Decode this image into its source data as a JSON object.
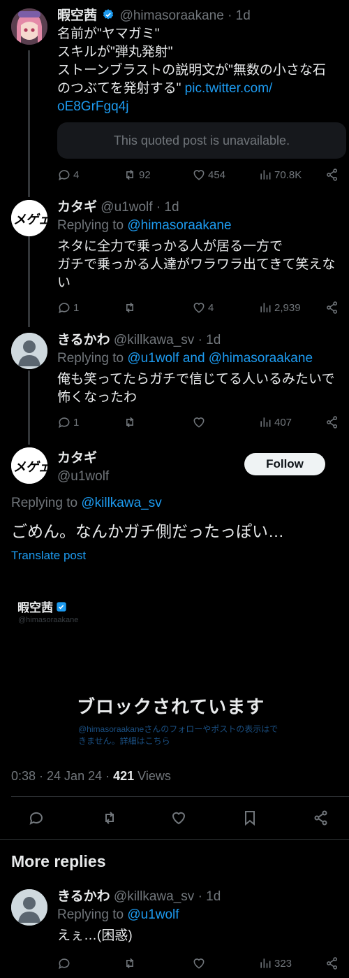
{
  "tweets": [
    {
      "name": "暇空茜",
      "handle": "@himasoraakane",
      "time": "· 1d",
      "text_lines": [
        "名前が\"ヤマガミ\"",
        "スキルが\"弾丸発射\"",
        "ストーンブラストの説明文が\"無数の小さな石",
        "のつぶてを発射する\""
      ],
      "link_inline": "pic.twitter.com/",
      "link_rest": "oE8GrFgq4j",
      "quoted": "This quoted post is unavailable.",
      "replies": "4",
      "retweets": "92",
      "likes": "454",
      "views": "70.8K"
    },
    {
      "name": "カタギ",
      "handle": "@u1wolf",
      "time": "· 1d",
      "replying_label": "Replying to",
      "replying_to": "@himasoraakane",
      "text_lines": [
        "ネタに全力で乗っかる人が居る一方で",
        "ガチで乗っかる人達がワラワラ出てきて笑えな",
        "い"
      ],
      "replies": "1",
      "retweets": "",
      "likes": "4",
      "views": "2,939"
    },
    {
      "name": "きるかわ",
      "handle": "@killkawa_sv",
      "time": "· 1d",
      "replying_label": "Replying to",
      "replying_to": "@u1wolf and @himasoraakane",
      "text_lines": [
        "俺も笑ってたらガチで信じてる人いるみたいで",
        "怖くなったわ"
      ],
      "replies": "1",
      "retweets": "",
      "likes": "",
      "views": "407"
    }
  ],
  "main": {
    "name": "カタギ",
    "handle": "@u1wolf",
    "follow_label": "Follow",
    "replying_label": "Replying to",
    "replying_to": "@killkawa_sv",
    "text": "ごめん。なんかガチ側だったっぽい…",
    "translate": "Translate post",
    "image": {
      "name": "暇空茜",
      "handle": "@himasoraakane",
      "block_title": "ブロックされています",
      "block_desc_line1": "@himasoraakaneさんのフォローやポストの表示はで",
      "block_desc_line2": "きません。詳細はこちら"
    },
    "time": "0:38 · 24 Jan 24 ·",
    "views_count": "421",
    "views_label": "Views"
  },
  "more_replies": {
    "title": "More replies",
    "reply": {
      "name": "きるかわ",
      "handle": "@killkawa_sv",
      "time": "· 1d",
      "replying_label": "Replying to",
      "replying_to": "@u1wolf",
      "text": "えぇ…(困惑)",
      "views": "323"
    }
  },
  "avatar_text": "メゲェ。",
  "colors": {
    "accent": "#1d9bf0",
    "muted": "#71767b",
    "text": "#e7e9ea",
    "bg": "#000000"
  }
}
